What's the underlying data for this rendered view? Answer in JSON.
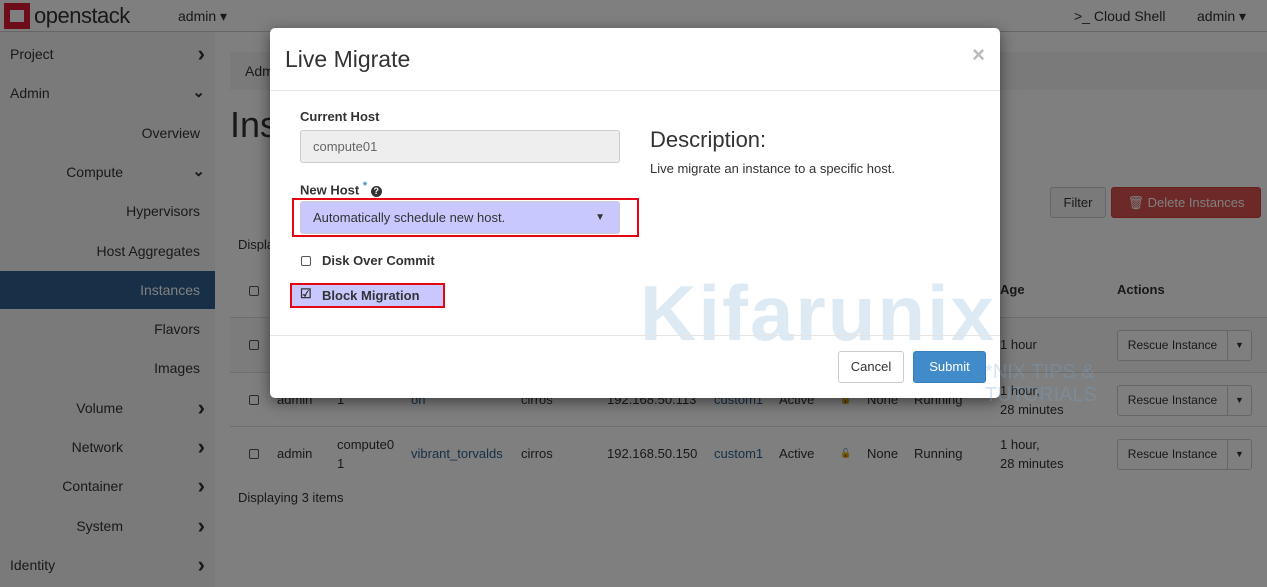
{
  "header": {
    "logo": "openstack",
    "project_menu": "admin ▾",
    "cloud_shell": ">_ Cloud Shell",
    "user_menu": "admin ▾"
  },
  "sidebar": {
    "items": [
      {
        "label": "Project",
        "level": 1,
        "chevron": "right"
      },
      {
        "label": "Admin",
        "level": 1,
        "chevron": "down"
      },
      {
        "label": "Overview",
        "level": 2
      },
      {
        "label": "Compute",
        "level": 2,
        "chevron": "down"
      },
      {
        "label": "Hypervisors",
        "level": 3
      },
      {
        "label": "Host Aggregates",
        "level": 3
      },
      {
        "label": "Instances",
        "level": 3,
        "active": true
      },
      {
        "label": "Flavors",
        "level": 3
      },
      {
        "label": "Images",
        "level": 3
      },
      {
        "label": "Volume",
        "level": 2,
        "chevron": "right"
      },
      {
        "label": "Network",
        "level": 2,
        "chevron": "right"
      },
      {
        "label": "Container",
        "level": 2,
        "chevron": "right"
      },
      {
        "label": "System",
        "level": 2,
        "chevron": "right"
      },
      {
        "label": "Identity",
        "level": 1,
        "chevron": "right"
      }
    ]
  },
  "main": {
    "breadcrumb": "Adm",
    "title": "Ins",
    "filter_button": "Filter",
    "delete_button": "🗑 Delete Instances",
    "displaying_top": "Displa",
    "displaying_bottom": "Displaying 3 items",
    "columns": {
      "age": "Age",
      "actions": "Actions"
    },
    "rows": [
      {
        "age": "1 hour",
        "action": "Rescue Instance"
      },
      {
        "project": "admin",
        "host": "1",
        "name": "on",
        "image": "cirros",
        "ip": "192.168.50.113",
        "flavor": "custom1",
        "status": "Active",
        "task": "None",
        "power": "Running",
        "age": "1 hour,\n28 minutes",
        "action": "Rescue Instance"
      },
      {
        "project": "admin",
        "host": "compute0\n1",
        "name": "vibrant_torvalds",
        "image": "cirros",
        "ip": "192.168.50.150",
        "flavor": "custom1",
        "status": "Active",
        "task": "None",
        "power": "Running",
        "age": "1 hour,\n28 minutes",
        "action": "Rescue Instance"
      }
    ]
  },
  "modal": {
    "title": "Live Migrate",
    "close": "×",
    "current_host_label": "Current Host",
    "current_host_value": "compute01",
    "new_host_label": "New Host",
    "required_mark": "*",
    "new_host_value": "Automatically schedule new host.",
    "disk_over_commit": "Disk Over Commit",
    "disk_over_commit_checked": false,
    "block_migration": "Block Migration",
    "block_migration_checked": true,
    "description_title": "Description:",
    "description_text": "Live migrate an instance to a specific host.",
    "cancel": "Cancel",
    "submit": "Submit"
  },
  "watermark": {
    "text": "Kifarunix",
    "tagline": "*NIX TIPS & TUTORIALS"
  },
  "colors": {
    "accent": "#31608f",
    "primary_button": "#428bca",
    "danger": "#d9534f",
    "highlight_box": "#e30613",
    "selection": "#c8c8ff"
  }
}
